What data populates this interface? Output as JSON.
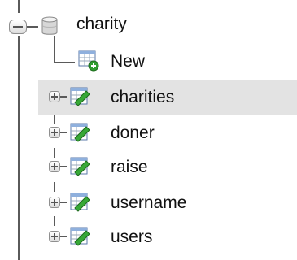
{
  "tree": {
    "database": {
      "label": "charity",
      "expanded": true,
      "icon": "database-icon"
    },
    "items": [
      {
        "label": "New",
        "icon": "new-table-icon",
        "expandable": false,
        "hovered": false
      },
      {
        "label": "charities",
        "icon": "table-icon",
        "expandable": true,
        "hovered": true
      },
      {
        "label": "doner",
        "icon": "table-icon",
        "expandable": true,
        "hovered": false
      },
      {
        "label": "raise",
        "icon": "table-icon",
        "expandable": true,
        "hovered": false
      },
      {
        "label": "username",
        "icon": "table-icon",
        "expandable": true,
        "hovered": false
      },
      {
        "label": "users",
        "icon": "table-icon",
        "expandable": true,
        "hovered": false
      }
    ]
  },
  "colors": {
    "hover_background": "#e3e3e3",
    "tree_line": "#5a5a5a",
    "text": "#111111"
  }
}
